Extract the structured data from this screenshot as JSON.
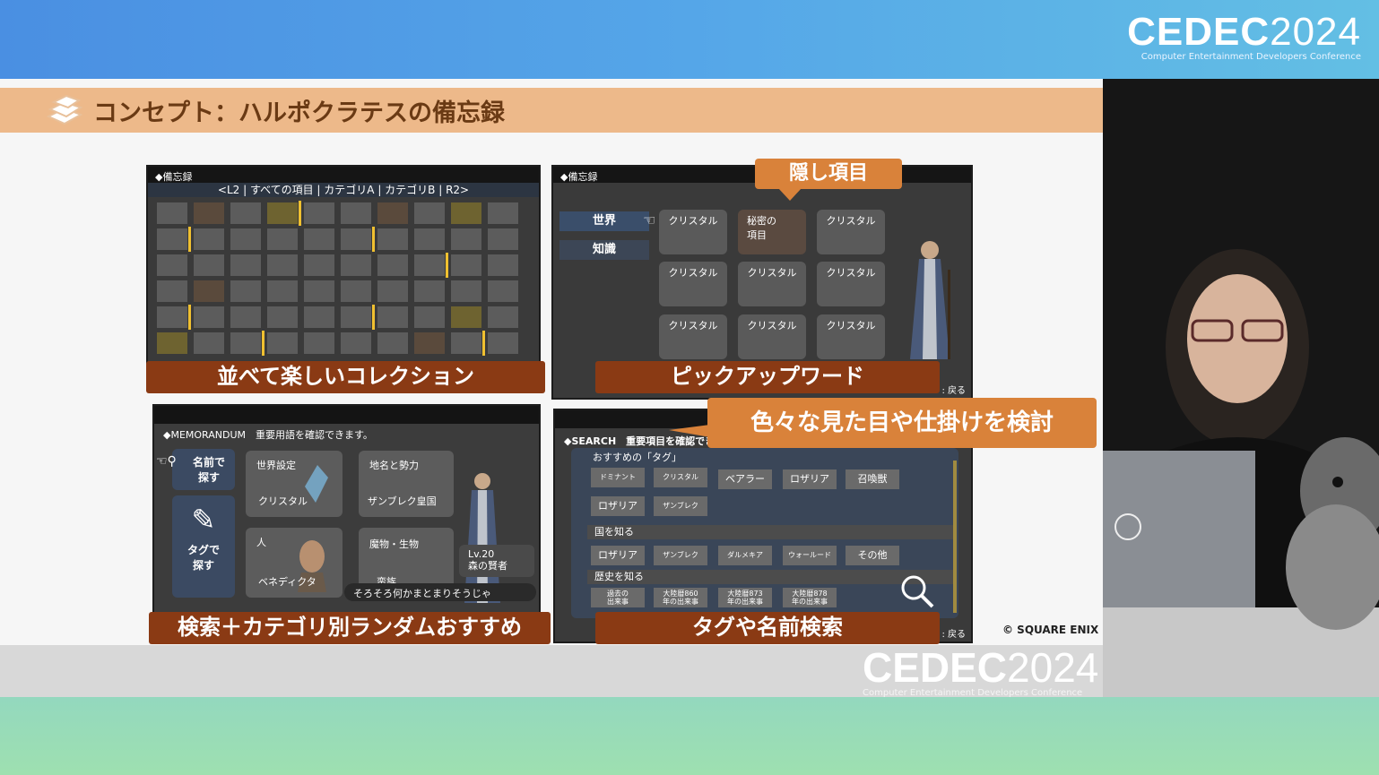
{
  "logo": {
    "main_bold": "CEDEC",
    "main_light": "2024",
    "sub": "Computer Entertainment Developers Conference"
  },
  "slide": {
    "title": "コンセプト：ハルポクラテスの備忘録",
    "copyright": "© SQUARE ENIX"
  },
  "panel1": {
    "header": "◆備忘録",
    "tabs": "<L2 | すべての項目 | カテゴリA | カテゴリB | R2>",
    "caption": "並べて楽しいコレクション"
  },
  "panel2": {
    "header": "◆備忘録",
    "callout": "隠し項目",
    "side": [
      "世界",
      "知識"
    ],
    "cards": [
      "クリスタル",
      "秘密の\n項目",
      "クリスタル",
      "クリスタル",
      "クリスタル",
      "クリスタル",
      "クリスタル",
      "クリスタル",
      "クリスタル"
    ],
    "back": ": 戻る",
    "caption": "ピックアップワード"
  },
  "panel3": {
    "header": "◆MEMORANDUM　重要用語を確認できます。",
    "search_name": "名前で\n探す",
    "search_tag": "タグで\n探す",
    "cards": [
      {
        "cat": "世界設定",
        "name": "クリスタル"
      },
      {
        "cat": "地名と勢力",
        "name": "ザンブレク皇国"
      },
      {
        "cat": "人",
        "name": "ベネディクタ"
      },
      {
        "cat": "魔物・生物",
        "name": "蛮族"
      }
    ],
    "level": "Lv.20\n森の賢者",
    "dialogue": "そろそろ何かまとまりそうじゃ",
    "caption": "検索＋カテゴリ別ランダムおすすめ"
  },
  "panel4": {
    "header": "◆SEARCH　重要項目を確認でき",
    "callout": "色々な見た目や仕掛けを検討",
    "rec_label": "おすすめの「タグ」",
    "tags_row1": [
      "ドミナント",
      "クリスタル",
      "ベアラー",
      "ロザリア",
      "召喚獣"
    ],
    "tags_row2": [
      "ロザリア",
      "ザンブレク"
    ],
    "country_label": "国を知る",
    "tags_row3": [
      "ロザリア",
      "ザンブレク",
      "ダルメキア",
      "ウォールード",
      "その他"
    ],
    "history_label": "歴史を知る",
    "tags_row4": [
      "過去の\n出来事",
      "大陸暦860\n年の出来事",
      "大陸暦873\n年の出来事",
      "大陸暦878\n年の出来事"
    ],
    "back": ": 戻る",
    "caption": "タグや名前検索"
  },
  "colors": {
    "caption_bg": "#8a3a14",
    "callout_bg": "#d9823a",
    "titlebar": "#edb98a"
  }
}
